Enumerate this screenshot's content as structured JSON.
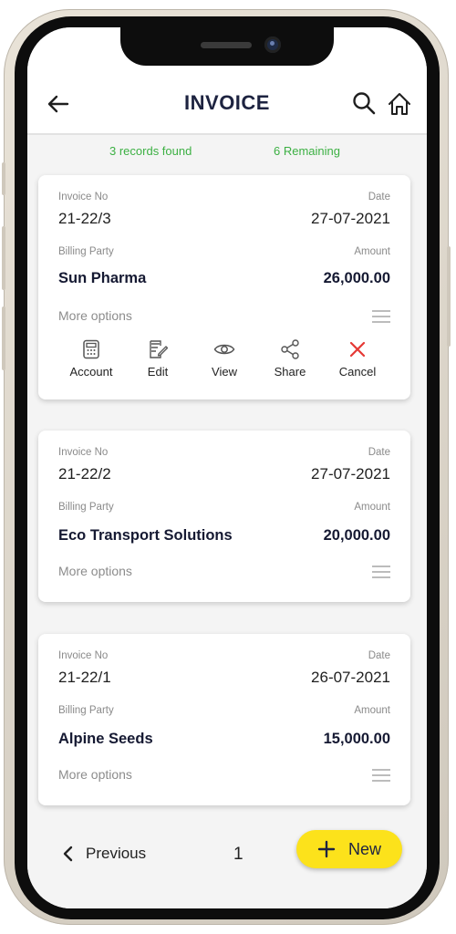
{
  "header": {
    "title": "INVOICE"
  },
  "summary": {
    "records_found": "3 records found",
    "remaining": "6 Remaining"
  },
  "labels": {
    "invoice_no": "Invoice No",
    "date": "Date",
    "billing_party": "Billing Party",
    "amount": "Amount",
    "more_options": "More options"
  },
  "invoices": [
    {
      "invoice_no": "21-22/3",
      "date": "27-07-2021",
      "billing_party": "Sun Pharma",
      "amount": "26,000.00"
    },
    {
      "invoice_no": "21-22/2",
      "date": "27-07-2021",
      "billing_party": "Eco Transport Solutions",
      "amount": "20,000.00"
    },
    {
      "invoice_no": "21-22/1",
      "date": "26-07-2021",
      "billing_party": "Alpine Seeds",
      "amount": "15,000.00"
    }
  ],
  "actions": [
    {
      "label": "Account",
      "icon": "calculator-icon"
    },
    {
      "label": "Edit",
      "icon": "edit-icon"
    },
    {
      "label": "View",
      "icon": "eye-icon"
    },
    {
      "label": "Share",
      "icon": "share-icon"
    },
    {
      "label": "Cancel",
      "icon": "close-icon"
    }
  ],
  "pagination": {
    "previous_label": "Previous",
    "page": "1"
  },
  "new_button": {
    "label": "New"
  },
  "colors": {
    "accent_green": "#3cb043",
    "new_button_yellow": "#fce21b",
    "title_navy": "#1d2340",
    "cancel_red": "#e53935"
  }
}
